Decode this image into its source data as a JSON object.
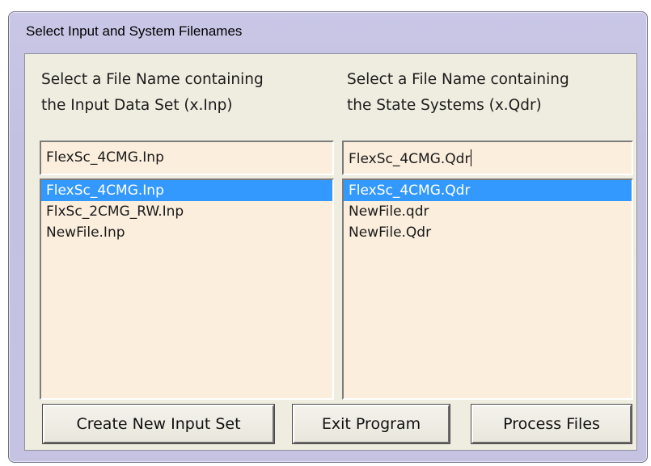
{
  "window": {
    "title": "Select Input and System Filenames"
  },
  "left_panel": {
    "heading_line1": "Select a File Name containing",
    "heading_line2": "the Input Data Set (x.Inp)",
    "filename_value": "FlexSc_4CMG.Inp",
    "items": [
      {
        "label": "FlexSc_4CMG.Inp",
        "selected": true
      },
      {
        "label": "FlxSc_2CMG_RW.Inp",
        "selected": false
      },
      {
        "label": "NewFile.Inp",
        "selected": false
      }
    ]
  },
  "right_panel": {
    "heading_line1": "Select a File Name containing",
    "heading_line2": "the State Systems (x.Qdr)",
    "filename_value": "FlexSc_4CMG.Qdr",
    "items": [
      {
        "label": "FlexSc_4CMG.Qdr",
        "selected": true
      },
      {
        "label": "NewFile.qdr",
        "selected": false
      },
      {
        "label": "NewFile.Qdr",
        "selected": false
      }
    ]
  },
  "buttons": {
    "create_label": "Create New Input Set",
    "exit_label": "Exit Program",
    "process_label": "Process Files"
  },
  "colors": {
    "window_frame": "#c6c3e2",
    "client_background": "#efece0",
    "field_background": "#fbeedd",
    "selection": "#3399ff"
  }
}
